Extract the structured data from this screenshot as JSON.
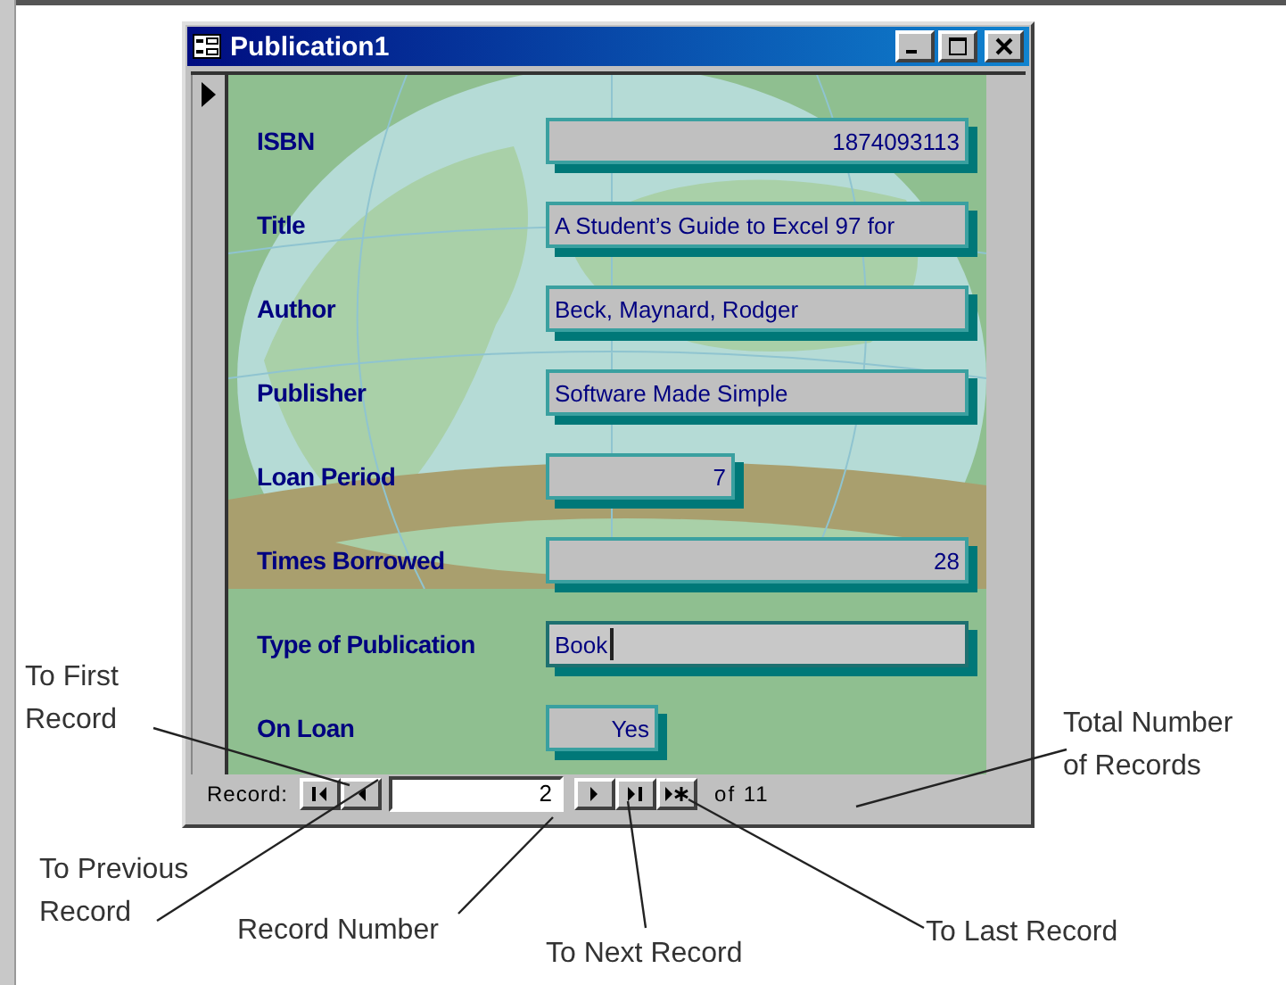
{
  "window": {
    "title": "Publication1"
  },
  "fields": [
    {
      "label": "ISBN",
      "value": "1874093113",
      "kind": "number-wide",
      "focused": false
    },
    {
      "label": "Title",
      "value": "A Student’s Guide to Excel 97 for",
      "kind": "text-wide",
      "focused": false
    },
    {
      "label": "Author",
      "value": "Beck, Maynard, Rodger",
      "kind": "text-wide",
      "focused": false
    },
    {
      "label": "Publisher",
      "value": "Software Made Simple",
      "kind": "text-wide",
      "focused": false
    },
    {
      "label": "Loan Period",
      "value": "7",
      "kind": "number-short",
      "focused": false
    },
    {
      "label": "Times Borrowed",
      "value": "28",
      "kind": "number-wide",
      "focused": false
    },
    {
      "label": "Type of Publication",
      "value": "Book",
      "kind": "text-wide",
      "focused": true
    },
    {
      "label": "On Loan",
      "value": "Yes",
      "kind": "yesno",
      "focused": false
    }
  ],
  "navigation": {
    "label": "Record:",
    "current": "2",
    "total": "of 11"
  },
  "annotations": [
    {
      "text": "To First\nRecord"
    },
    {
      "text": "Total Number\nof Records"
    },
    {
      "text": "To Previous\nRecord"
    },
    {
      "text": "Record Number"
    },
    {
      "text": "To Next Record"
    },
    {
      "text": "To Last Record"
    }
  ]
}
